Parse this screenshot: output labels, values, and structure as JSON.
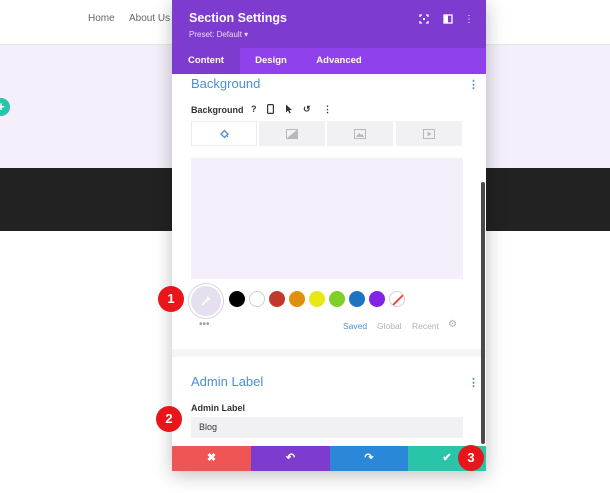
{
  "nav": {
    "items": [
      "Home",
      "About Us"
    ]
  },
  "modal": {
    "title": "Section Settings",
    "preset": "Preset: Default ▾",
    "tabs": [
      "Content",
      "Design",
      "Advanced"
    ],
    "active_tab": "Content",
    "header_icons": [
      "fullscreen-icon",
      "split-view-icon",
      "more-options-icon"
    ]
  },
  "background_section": {
    "title": "Background",
    "field_label": "Background",
    "field_icons": [
      "help-icon",
      "responsive-icon",
      "hover-icon",
      "reset-icon",
      "more-icon"
    ],
    "bg_tabs": [
      "color-tab",
      "gradient-tab",
      "image-tab",
      "video-tab"
    ],
    "active_bg_tab": "color-tab",
    "preview_color": "#f4effa",
    "swatches": [
      "#000000",
      "#ffffff",
      "#c0392b",
      "#e0900f",
      "#e8e817",
      "#7ecf29",
      "#1e73be",
      "#8224e3",
      "none"
    ],
    "more_dots": "•••",
    "color_tabs": [
      "Saved",
      "Global",
      "Recent"
    ],
    "active_color_tab": "Saved"
  },
  "admin_section": {
    "title": "Admin Label",
    "field_label": "Admin Label",
    "input_value": "Blog"
  },
  "footer": {
    "buttons": [
      {
        "name": "cancel",
        "glyph": "✖",
        "color": "#ef5555"
      },
      {
        "name": "undo",
        "glyph": "↶",
        "color": "#7e3bd0"
      },
      {
        "name": "redo",
        "glyph": "↷",
        "color": "#2b87da"
      },
      {
        "name": "save",
        "glyph": "✔",
        "color": "#29c4a9"
      }
    ]
  },
  "badges": [
    "1",
    "2",
    "3"
  ],
  "colors": {
    "purple_dark": "#7e3bd0",
    "purple_light": "#8f42ec",
    "blue_accent": "#4a8fd6",
    "badge_red": "#e8161b"
  }
}
